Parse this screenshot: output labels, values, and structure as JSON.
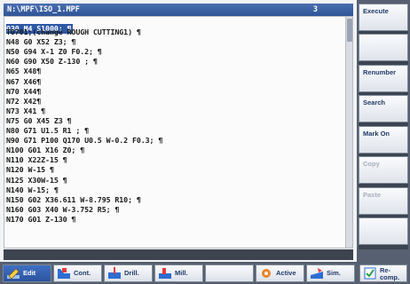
{
  "header": {
    "path": "N:\\MPF\\ISO_1.MPF",
    "channel": "3"
  },
  "program_lines": [
    "O30 M4 S1000; ¶",
    "T0701;(change ROUGH CUTTING1) ¶",
    "N48 G0 X52 Z3; ¶",
    "N50 G94 X-1 Z0 F0.2; ¶",
    "N60 G90 X50 Z-130 ; ¶",
    "N65 X48¶",
    "N67 X46¶",
    "N70 X44¶",
    "N72 X42¶",
    "N73 X41 ¶",
    "N75 G0 X45 Z3 ¶",
    "N80 G71 U1.5 R1 ; ¶",
    "N90 G71 P100 Q170 U0.5 W-0.2 F0.3; ¶",
    "N100 G01 X16 Z0; ¶",
    "N110 X22Z-15 ¶",
    "N120 W-15 ¶",
    "N125 X30W-15 ¶",
    "N140 W-15; ¶",
    "N150 G02 X36.611 W-8.795 R10; ¶",
    "N160 G03 X40 W-3.752 R5; ¶",
    "N170 G01 Z-130 ¶"
  ],
  "selected_line": 0,
  "softkeys": [
    {
      "label": "Execute",
      "enabled": true
    },
    {
      "label": "",
      "enabled": true
    },
    {
      "label": "Renumber",
      "enabled": true
    },
    {
      "label": "Search",
      "enabled": true
    },
    {
      "label": "Mark On",
      "enabled": true
    },
    {
      "label": "Copy",
      "enabled": false
    },
    {
      "label": "Paste",
      "enabled": false
    },
    {
      "label": "",
      "enabled": true
    },
    {
      "label": "",
      "enabled": true
    }
  ],
  "bottom_keys": [
    {
      "label": "Edit",
      "icon": "edit-pencil-icon",
      "active": true
    },
    {
      "label": "Cont.",
      "icon": "contour-icon",
      "active": false
    },
    {
      "label": "Drill.",
      "icon": "drill-icon",
      "active": false
    },
    {
      "label": "Mill.",
      "icon": "mill-icon",
      "active": false
    },
    {
      "label": "",
      "icon": "",
      "active": false
    },
    {
      "label": "Active",
      "icon": "active-gear-icon",
      "active": false
    },
    {
      "label": "Sim.",
      "icon": "simulation-icon",
      "active": false
    },
    {
      "label": "Re-comp.",
      "icon": "recompile-icon",
      "active": false
    }
  ],
  "colors": {
    "accent": "#2e58a6",
    "panel": "#566070",
    "key_text": "#1f3a6b"
  }
}
